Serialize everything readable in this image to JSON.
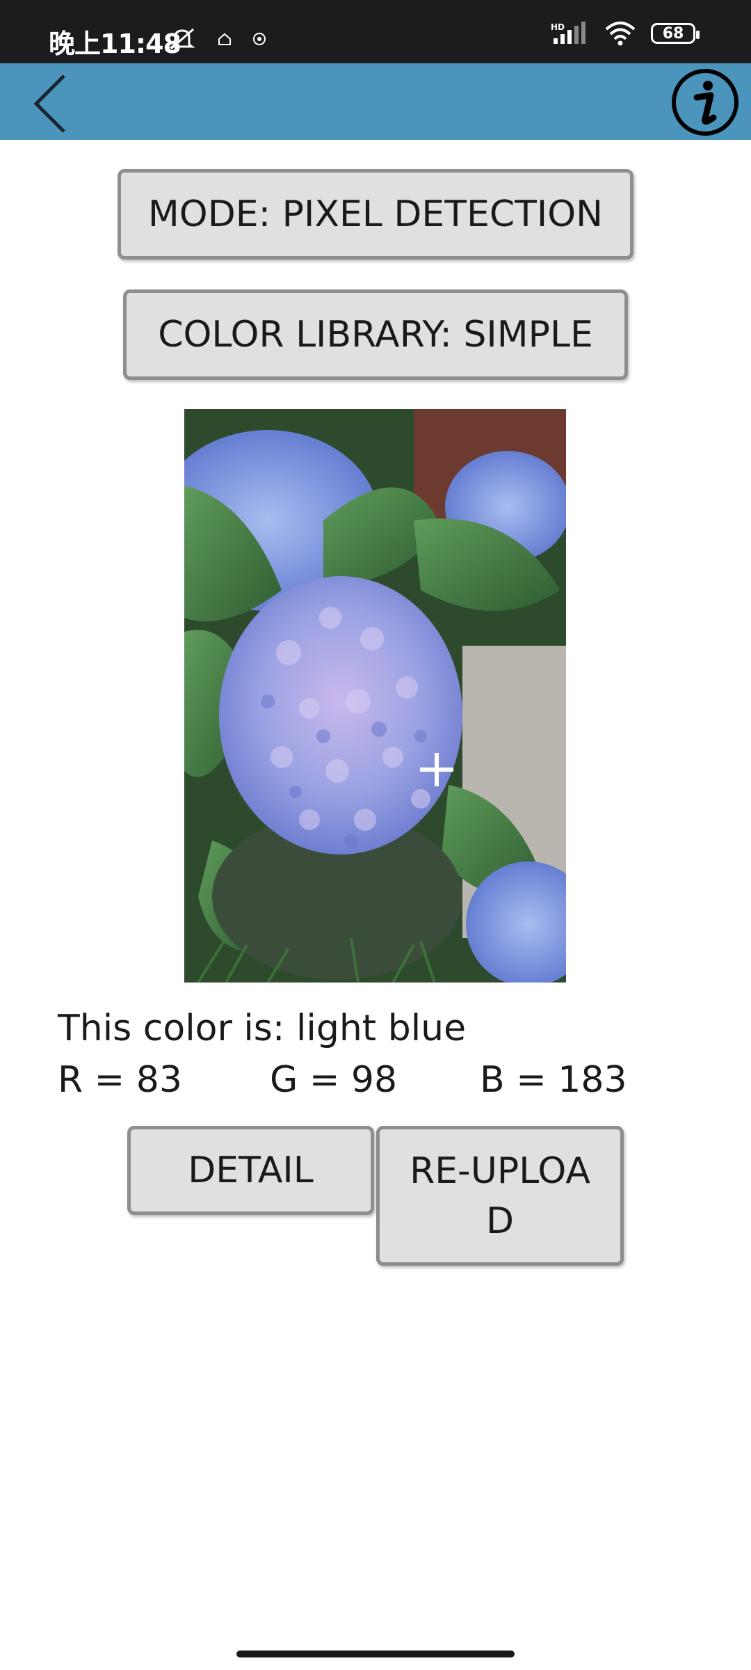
{
  "status_bar": {
    "time": "晚上11:48",
    "battery": "68",
    "network_label": "HD"
  },
  "app_bar": {
    "back_icon": "chevron-left-icon",
    "info_icon": "info-circle-icon",
    "color": "#4b95bc"
  },
  "buttons": {
    "mode": "MODE: PIXEL DETECTION",
    "library": "COLOR LIBRARY: SIMPLE",
    "detail": "DETAIL",
    "reupload_line1": "RE-UPLOA",
    "reupload_line2": "D"
  },
  "result": {
    "color_name_text": "This color is: light blue",
    "r_text": "R = 83",
    "g_text": "G = 98",
    "b_text": "B = 183"
  },
  "photo": {
    "subject": "hydrangea-flower-photo"
  }
}
